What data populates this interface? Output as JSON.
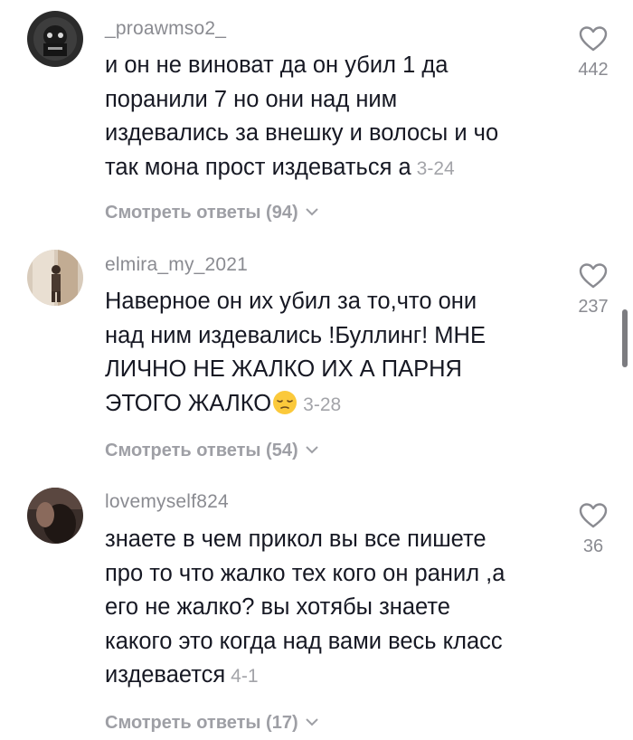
{
  "comments": [
    {
      "username": "_proawmso2_",
      "text_lines": [
        "и он не виноват да он убил 1 да",
        "поранили 7 но они над ним",
        "издевались за внешку и волосы и чо",
        "так мона прост издеваться а"
      ],
      "date": "3-24",
      "replies_label": "Смотреть ответы (94)",
      "likes": "442",
      "avatar_icon": "dark-figure-avatar"
    },
    {
      "username": "elmira_my_2021",
      "text_lines": [
        "Наверное он их убил за то,что они",
        "над ним издевались !Буллинг! МНЕ",
        "ЛИЧНО НЕ ЖАЛКО ИХ А ПАРНЯ",
        "ЭТОГО ЖАЛКО"
      ],
      "emoji": "pensive-face-emoji",
      "date": "3-28",
      "replies_label": "Смотреть ответы (54)",
      "likes": "237",
      "avatar_icon": "mirror-selfie-avatar"
    },
    {
      "username": "lovemyself824",
      "text_lines": [
        "знаете в чем прикол вы все пишете",
        "про то что жалко тех кого он ранил ,а",
        "его не жалко? вы хотябы знаете",
        "какого это когда над вами весь класс",
        "издевается"
      ],
      "date": "4-1",
      "replies_label": "Смотреть ответы (17)",
      "likes": "36",
      "avatar_icon": "dark-hair-avatar"
    }
  ],
  "colors": {
    "text": "#161823",
    "muted": "#8a8b91",
    "date": "#a3a4a9",
    "replies": "#9e9fa5"
  }
}
